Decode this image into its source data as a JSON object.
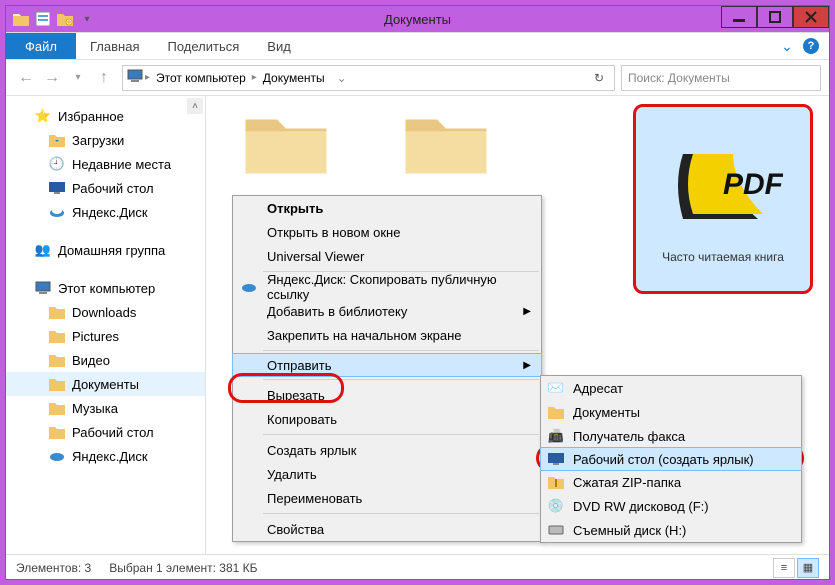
{
  "window": {
    "title": "Документы"
  },
  "ribbon": {
    "file": "Файл",
    "tabs": [
      "Главная",
      "Поделиться",
      "Вид"
    ]
  },
  "address": {
    "segments": [
      "Этот компьютер",
      "Документы"
    ],
    "search_placeholder": "Поиск: Документы"
  },
  "sidebar": {
    "favorites": {
      "label": "Избранное",
      "items": [
        {
          "label": "Загрузки",
          "icon": "downloads"
        },
        {
          "label": "Недавние места",
          "icon": "recent"
        },
        {
          "label": "Рабочий стол",
          "icon": "desktop"
        },
        {
          "label": "Яндекс.Диск",
          "icon": "yadisk"
        }
      ]
    },
    "homegroup": {
      "label": "Домашняя группа"
    },
    "thispc": {
      "label": "Этот компьютер",
      "items": [
        {
          "label": "Downloads",
          "icon": "folder"
        },
        {
          "label": "Pictures",
          "icon": "folder"
        },
        {
          "label": "Видео",
          "icon": "folder"
        },
        {
          "label": "Документы",
          "icon": "folder",
          "selected": true
        },
        {
          "label": "Музыка",
          "icon": "folder"
        },
        {
          "label": "Рабочий стол",
          "icon": "folder"
        },
        {
          "label": "Яндекс.Диск",
          "icon": "yadisk"
        }
      ]
    }
  },
  "selected_item": {
    "label": "Часто читаемая книга"
  },
  "context_menu": {
    "open": "Открыть",
    "open_new": "Открыть в новом окне",
    "uviewer": "Universal Viewer",
    "yadisk_copy": "Яндекс.Диск: Скопировать публичную ссылку",
    "add_lib": "Добавить в библиотеку",
    "pin_start": "Закрепить на начальном экране",
    "send_to": "Отправить",
    "cut": "Вырезать",
    "copy": "Копировать",
    "shortcut": "Создать ярлык",
    "delete": "Удалить",
    "rename": "Переименовать",
    "properties": "Свойства"
  },
  "send_to_menu": {
    "items": [
      {
        "label": "Адресат",
        "icon": "mail"
      },
      {
        "label": "Документы",
        "icon": "folder"
      },
      {
        "label": "Получатель факса",
        "icon": "fax"
      },
      {
        "label": "Рабочий стол (создать ярлык)",
        "icon": "desktop",
        "hl": true
      },
      {
        "label": "Сжатая ZIP-папка",
        "icon": "zip"
      },
      {
        "label": "DVD RW дисковод (F:)",
        "icon": "dvd"
      },
      {
        "label": "Съемный диск (H:)",
        "icon": "usb"
      }
    ]
  },
  "status": {
    "count_label": "Элементов: 3",
    "selection_label": "Выбран 1 элемент: 381 КБ"
  }
}
